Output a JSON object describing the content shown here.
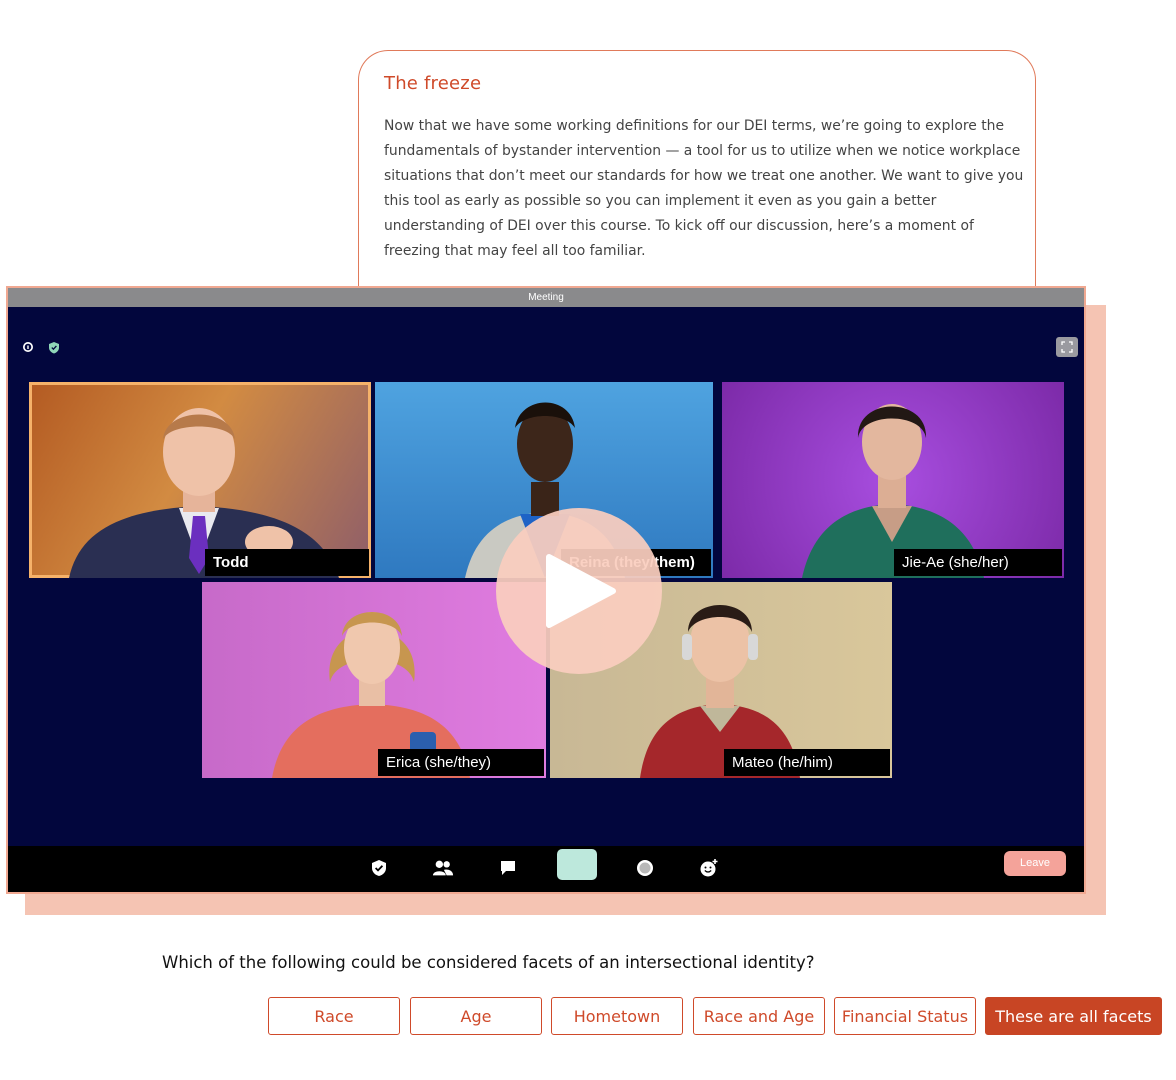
{
  "intro": {
    "title": "The freeze",
    "body": "Now that we have some working definitions for our DEI terms, we’re going to explore the fundamentals of bystander intervention — a tool for us to utilize when we notice workplace situations that don’t meet our standards for how we treat one another. We want to give you this tool as early as possible so you can implement it even as you gain a better understanding of DEI over this course. To kick off our discussion, here’s a moment of freezing that may feel all too familiar."
  },
  "meeting": {
    "window_title": "Meeting",
    "participants": [
      {
        "name": "Todd",
        "bg": "#c0763a"
      },
      {
        "name": "Reina (they/them)",
        "bg": "#3f8fd0"
      },
      {
        "name": "Jie-Ae (she/her)",
        "bg": "#9a3fd0"
      },
      {
        "name": "Erica (she/they)",
        "bg": "#c465c9"
      },
      {
        "name": "Mateo (he/him)",
        "bg": "#c8b98f"
      }
    ],
    "leave_label": "Leave",
    "icons": [
      "info-icon",
      "shield-icon",
      "fullscreen-icon",
      "security-icon",
      "participants-icon",
      "chat-icon",
      "record-icon",
      "reaction-icon",
      "play-icon"
    ]
  },
  "quiz": {
    "question": "Which of the following could be considered facets of an intersectional identity?",
    "options": [
      {
        "label": "Race"
      },
      {
        "label": "Age"
      },
      {
        "label": "Hometown"
      },
      {
        "label": "Race and Age"
      },
      {
        "label": "Financial Status"
      },
      {
        "label": "These are all facets",
        "selected": true
      }
    ]
  },
  "colors": {
    "accent": "#cf4a2a",
    "meeting_bg": "#02063d",
    "play_overlay": "#facdbe"
  }
}
